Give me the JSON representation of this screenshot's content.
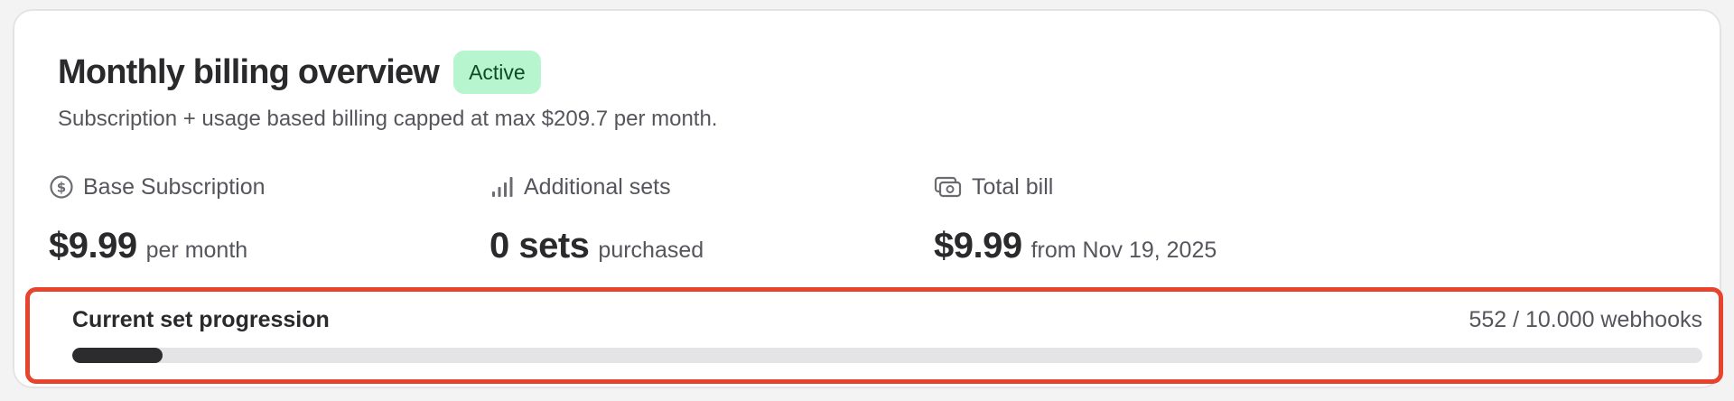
{
  "billing": {
    "title": "Monthly billing overview",
    "status_badge": "Active",
    "subtitle": "Subscription + usage based billing capped at max $209.7 per month."
  },
  "stats": {
    "base": {
      "icon": "dollar-circle-icon",
      "label": "Base Subscription",
      "value": "$9.99",
      "suffix": "per month"
    },
    "additional": {
      "icon": "signal-bars-icon",
      "label": "Additional sets",
      "value": "0 sets",
      "suffix": "purchased"
    },
    "total": {
      "icon": "money-stack-icon",
      "label": "Total bill",
      "value": "$9.99",
      "suffix": "from Nov 19, 2025"
    }
  },
  "progress": {
    "title": "Current set progression",
    "count_text": "552 / 10.000 webhooks",
    "fraction": 0.0552
  },
  "colors": {
    "badge_bg": "#b6f5cd",
    "badge_text": "#0d4a26",
    "highlight_border": "#e8432c",
    "progress_fill": "#2c2c2f",
    "progress_track": "#e4e4e6"
  }
}
